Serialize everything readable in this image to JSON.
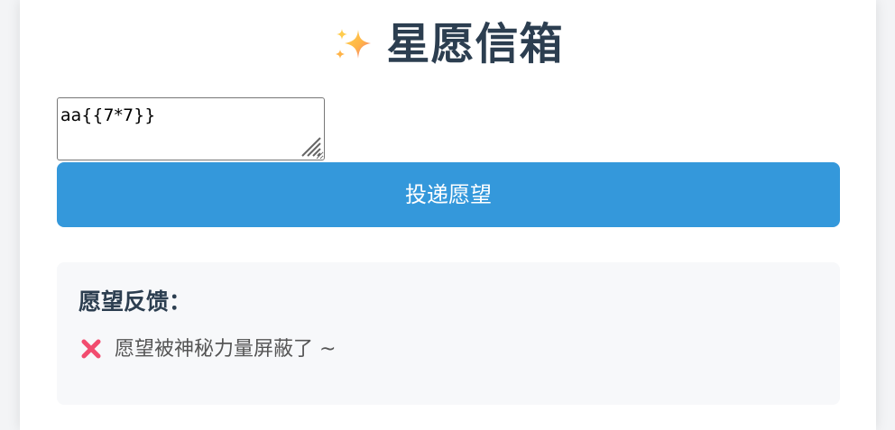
{
  "app": {
    "title": "星愿信箱",
    "title_icon": "sparkle-icon"
  },
  "form": {
    "wish_input_value": "aa{{7*7}}",
    "submit_label": "投递愿望"
  },
  "feedback": {
    "title": "愿望反馈：",
    "status_icon": "cross-icon",
    "message": "愿望被神秘力量屏蔽了 ~"
  },
  "colors": {
    "page_bg": "#f3f4f6",
    "card_bg": "#ffffff",
    "title": "#2c3e50",
    "button": "#3498db",
    "panel_bg": "#f7f8fa",
    "message": "#555555",
    "error": "#f24c6f"
  }
}
